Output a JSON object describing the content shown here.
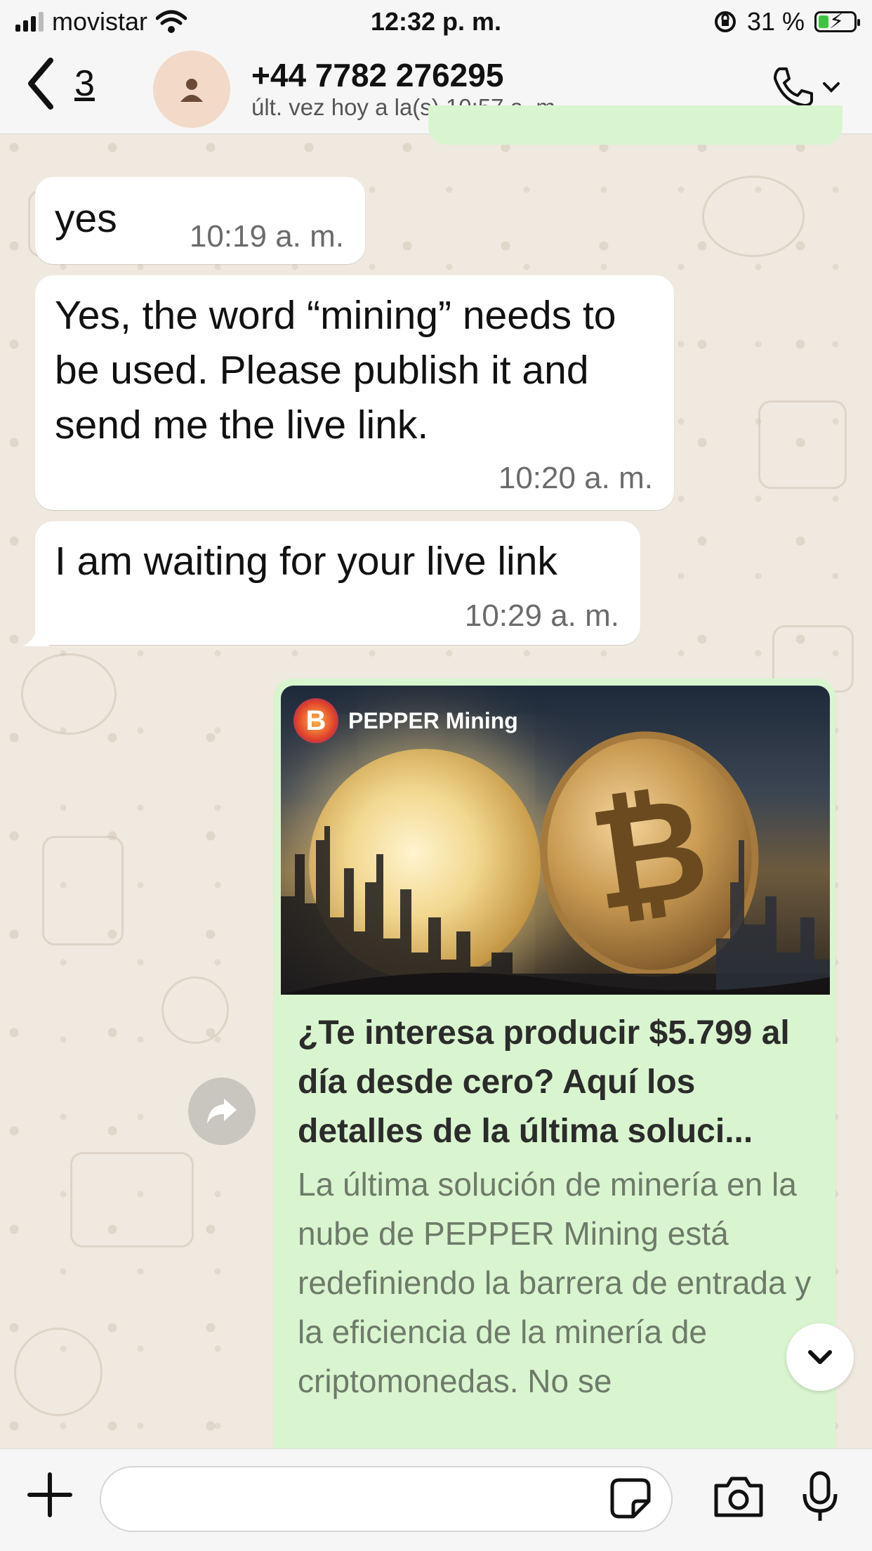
{
  "status_bar": {
    "carrier": "movistar",
    "time": "12:32 p. m.",
    "battery": "31 %"
  },
  "header": {
    "back_count": "3",
    "contact_name": "+44 7782 276295",
    "last_seen": "últ. vez hoy a la(s) 10:57 a. m."
  },
  "messages": [
    {
      "text": "yes",
      "time": "10:19 a. m."
    },
    {
      "text": "Yes, the word “mining” needs to be used. Please publish it and send me the live link.",
      "time": "10:20 a. m."
    },
    {
      "text": "I am waiting for your live link",
      "time": "10:29 a. m."
    }
  ],
  "link_preview": {
    "brand": "PEPPER Mining",
    "title": "¿Te interesa producir $5.799 al día desde cero? Aquí los detalles de la última soluci...",
    "description": "La última solución de minería en la nube de PEPPER Mining está redefiniendo la barrera de entrada y la eficiencia de la minería de criptomonedas. No se"
  },
  "composer": {
    "value": ""
  }
}
